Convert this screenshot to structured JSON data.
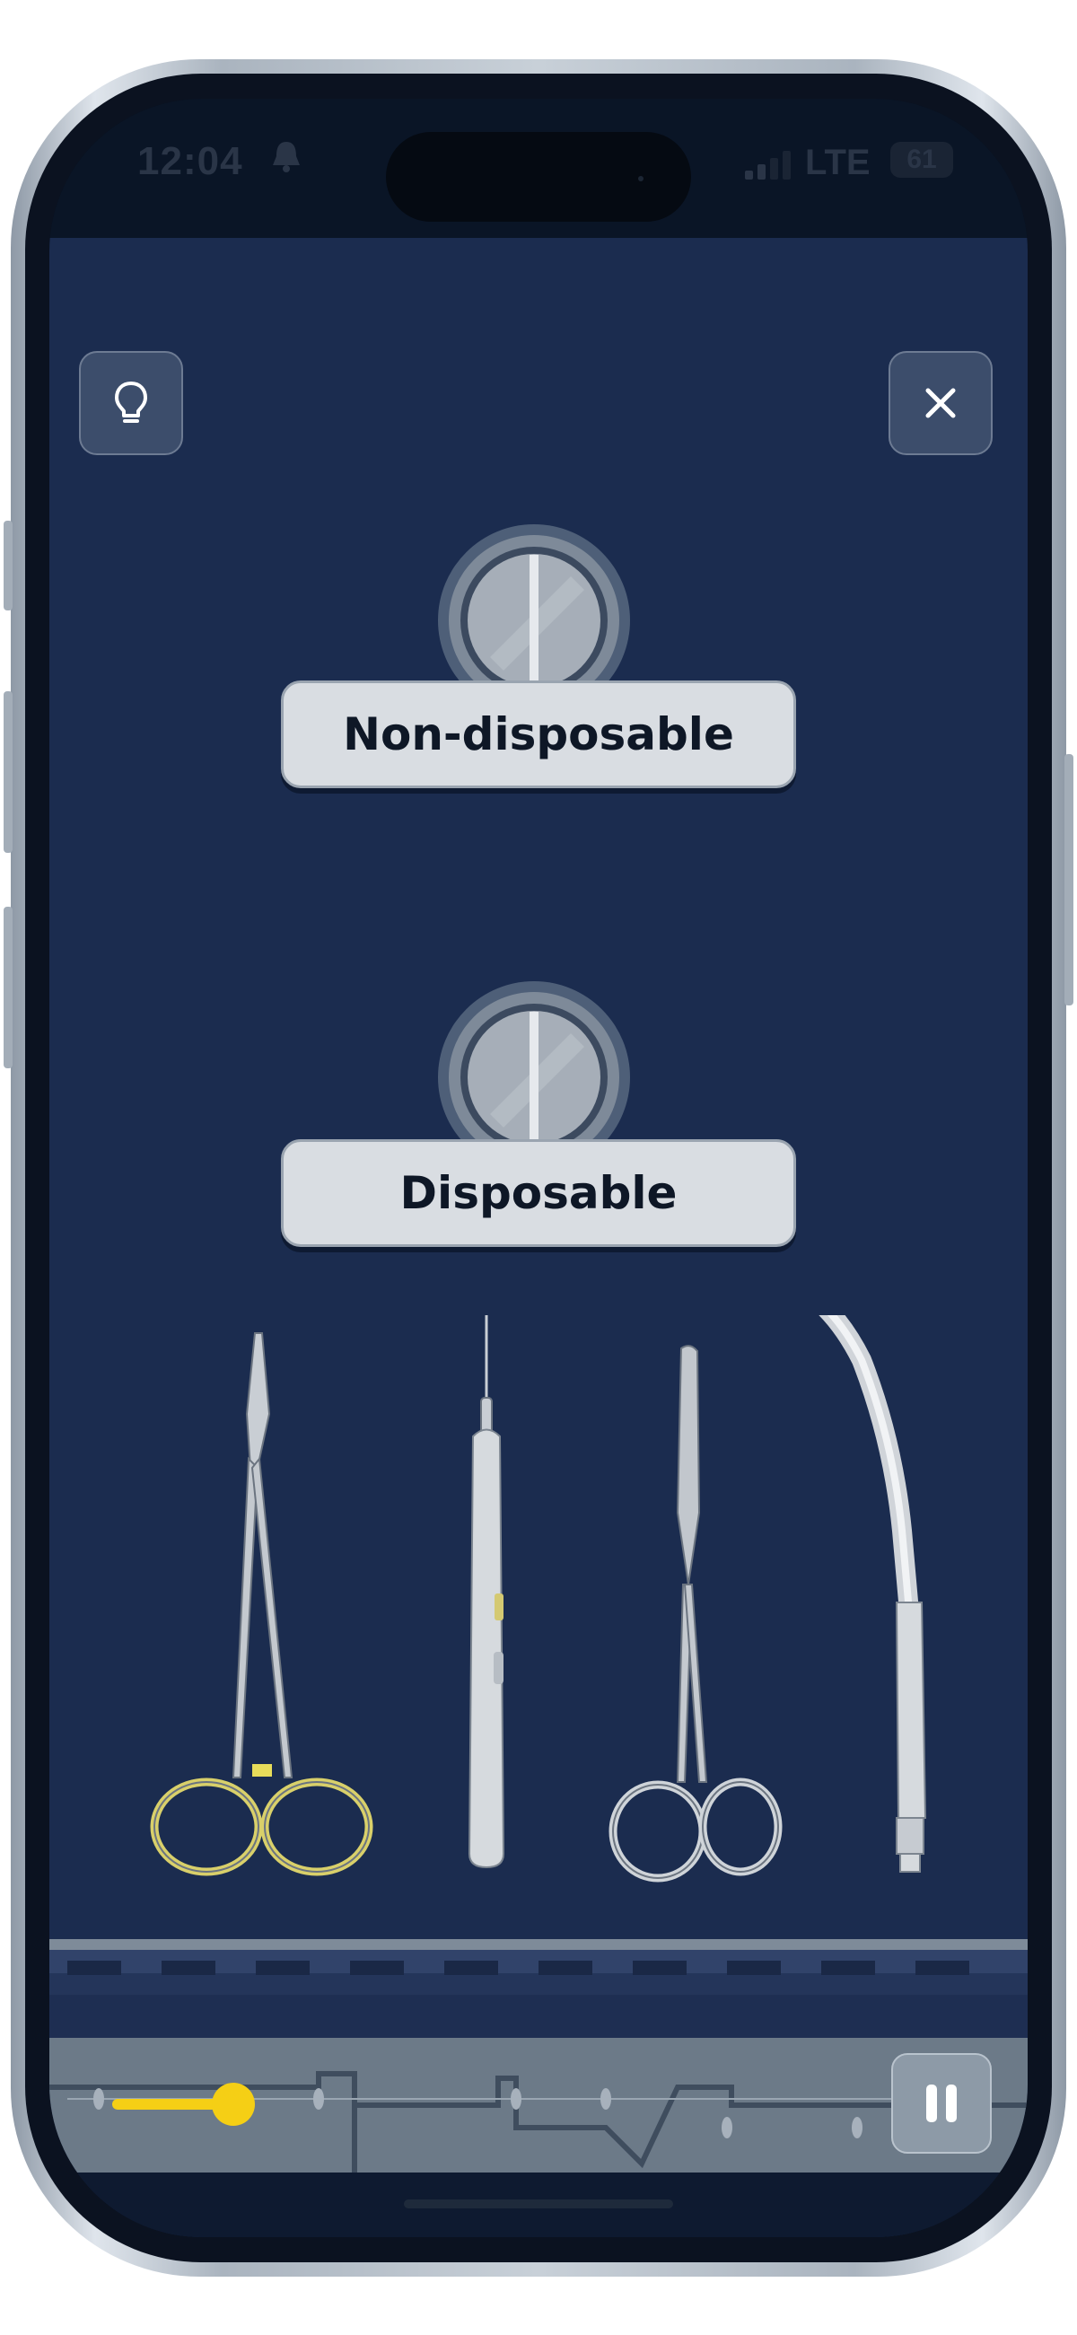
{
  "status_bar": {
    "time": "12:04",
    "notification_icon": "bell-icon",
    "network": "LTE",
    "battery": "61"
  },
  "toolbar": {
    "hint_icon": "lightbulb-icon",
    "close_icon": "close-icon"
  },
  "categories": [
    {
      "label": "Non-disposable"
    },
    {
      "label": "Disposable"
    }
  ],
  "instruments": [
    {
      "icon": "needle-holder-icon"
    },
    {
      "icon": "electrosurgical-pencil-icon"
    },
    {
      "icon": "scissors-icon"
    },
    {
      "icon": "suction-tip-icon"
    }
  ],
  "controls": {
    "progress": 0.3,
    "pause_icon": "pause-icon"
  },
  "colors": {
    "background": "#1b2c4f",
    "accent": "#f5cf15",
    "label_bg": "#d9dde2"
  }
}
